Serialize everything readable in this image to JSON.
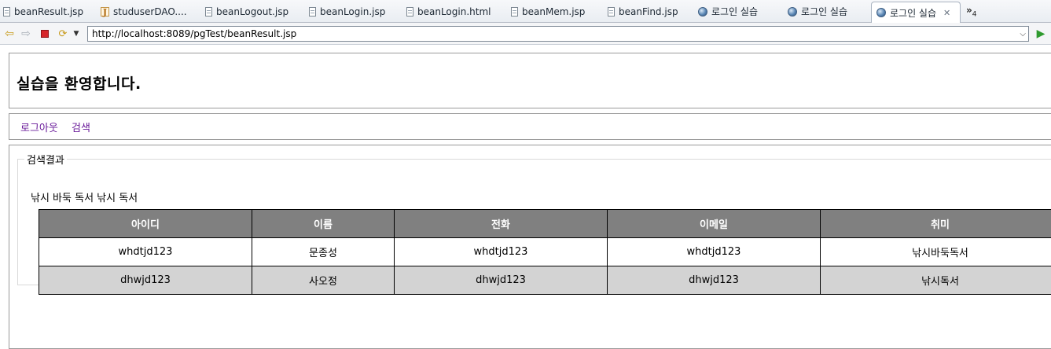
{
  "editor_tabs": [
    {
      "label": "beanResult.jsp",
      "icon": "jsp-file-icon"
    },
    {
      "label": "studuserDAO....",
      "icon": "java-file-icon"
    },
    {
      "label": "beanLogout.jsp",
      "icon": "jsp-file-icon"
    },
    {
      "label": "beanLogin.jsp",
      "icon": "jsp-file-icon"
    },
    {
      "label": "beanLogin.html",
      "icon": "html-file-icon"
    },
    {
      "label": "beanMem.jsp",
      "icon": "jsp-file-icon"
    },
    {
      "label": "beanFind.jsp",
      "icon": "jsp-file-icon"
    },
    {
      "label": "로그인 실습",
      "icon": "globe-icon"
    },
    {
      "label": "로그인 실습",
      "icon": "globe-icon"
    },
    {
      "label": "로그인 실습",
      "icon": "globe-icon",
      "active": true
    }
  ],
  "tab_overflow": {
    "symbol": "»",
    "count": "4"
  },
  "browser": {
    "url": "http://localhost:8089/pgTest/beanResult.jsp"
  },
  "page": {
    "title": "실습을 환영합니다.",
    "nav": [
      "로그아웃",
      "검색"
    ],
    "legend": "검색결과",
    "hobbies_text": "낚시 바둑 독서 낚시 독서",
    "table": {
      "headers": [
        "아이디",
        "이름",
        "전화",
        "이메일",
        "취미"
      ],
      "rows": [
        [
          "whdtjd123",
          "문종성",
          "whdtjd123",
          "whdtjd123",
          "낚시바둑독서"
        ],
        [
          "dhwjd123",
          "사오정",
          "dhwjd123",
          "dhwjd123",
          "낚시독서"
        ]
      ]
    }
  },
  "colors": {
    "table_header_bg": "#808080",
    "row_alt_bg": "#d3d3d3",
    "nav_link": "#6a1b9a"
  }
}
